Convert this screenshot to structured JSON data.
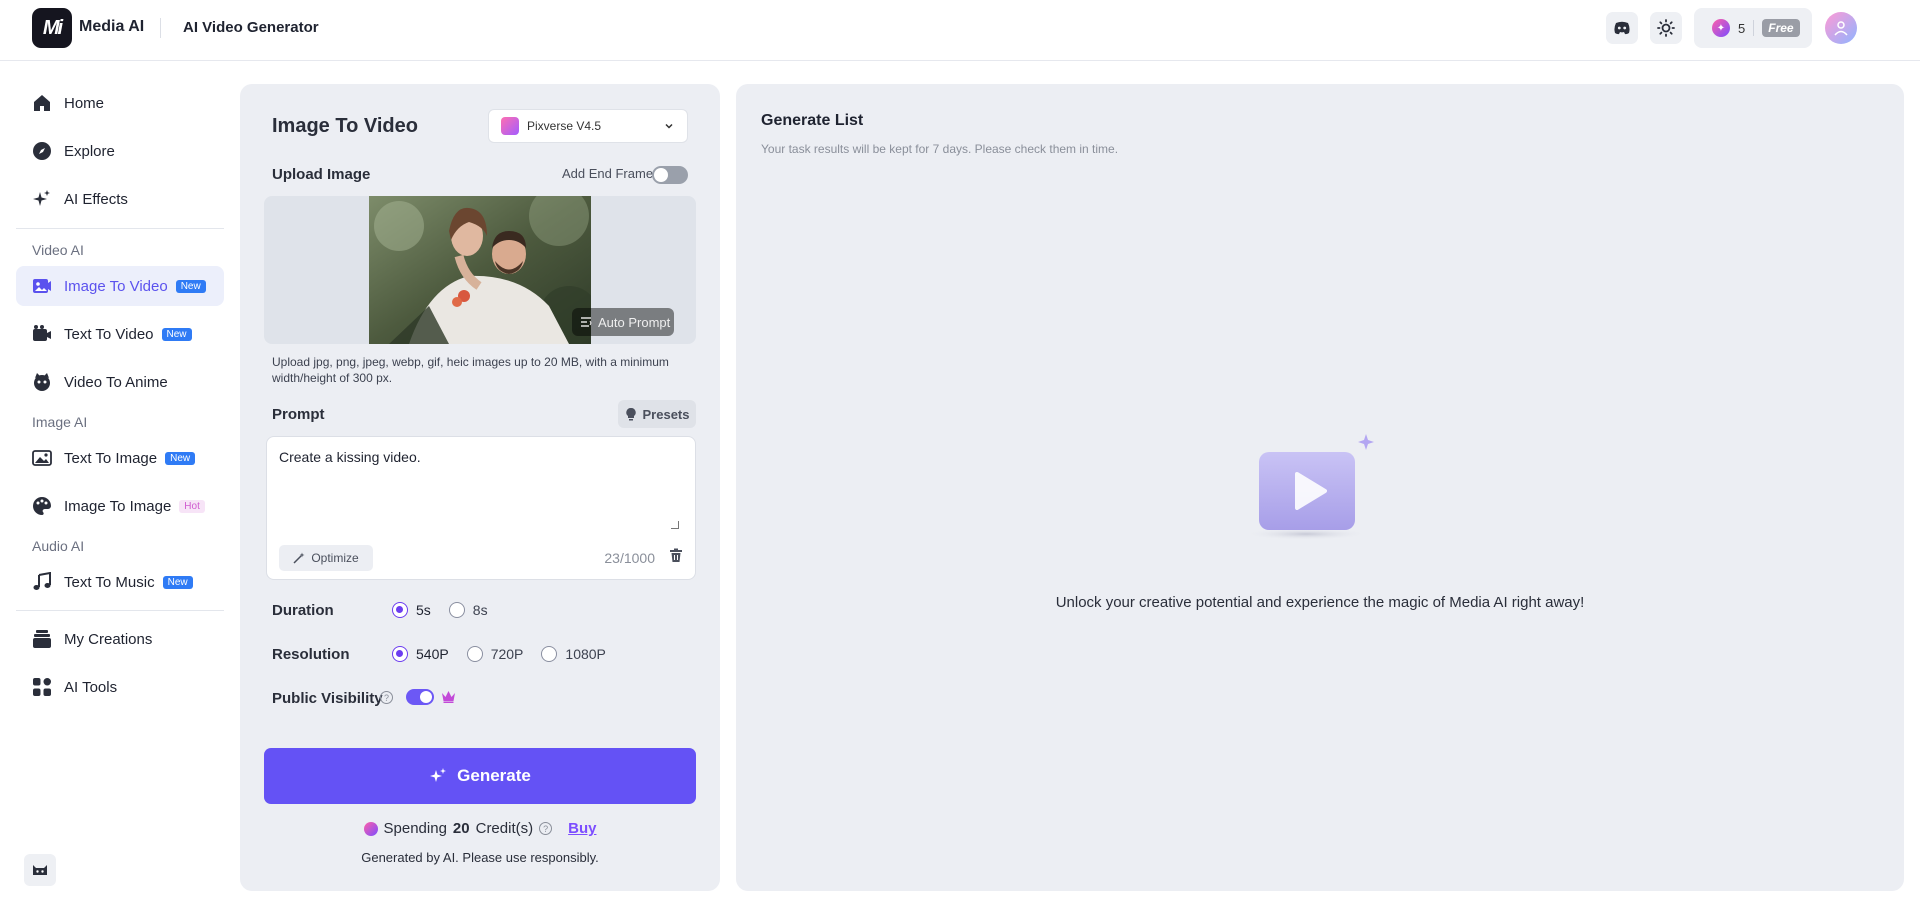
{
  "header": {
    "logo_text": "Mi",
    "app_name": "Media AI",
    "page_title": "AI Video Generator",
    "credits": "5",
    "plan_badge": "Free"
  },
  "sidebar": {
    "items_top": [
      {
        "label": "Home",
        "icon": "home-icon"
      },
      {
        "label": "Explore",
        "icon": "compass-icon"
      },
      {
        "label": "AI Effects",
        "icon": "sparkles-icon"
      }
    ],
    "section_video": "Video AI",
    "video_items": [
      {
        "label": "Image To Video",
        "badge": "New",
        "active": true
      },
      {
        "label": "Text To Video",
        "badge": "New"
      },
      {
        "label": "Video To Anime",
        "badge": ""
      }
    ],
    "section_image": "Image AI",
    "image_items": [
      {
        "label": "Text To Image",
        "badge": "New"
      },
      {
        "label": "Image To Image",
        "badge": "Hot"
      }
    ],
    "section_audio": "Audio AI",
    "audio_items": [
      {
        "label": "Text To Music",
        "badge": "New"
      }
    ],
    "items_bottom": [
      {
        "label": "My Creations",
        "icon": "layers-icon"
      },
      {
        "label": "AI Tools",
        "icon": "grid-icon"
      }
    ]
  },
  "form": {
    "title": "Image To Video",
    "model": "Pixverse V4.5",
    "upload_label": "Upload Image",
    "end_frame_label": "Add End Frame",
    "end_frame_on": false,
    "auto_prompt": "Auto Prompt",
    "upload_hint": "Upload jpg, png, jpeg, webp, gif, heic images up to 20 MB, with a minimum width/height of 300 px.",
    "prompt_label": "Prompt",
    "presets": "Presets",
    "prompt_value": "Create a kissing video.",
    "optimize": "Optimize",
    "char_count": "23/1000",
    "duration_label": "Duration",
    "duration_options": [
      "5s",
      "8s"
    ],
    "duration_selected": "5s",
    "resolution_label": "Resolution",
    "resolution_options": [
      "540P",
      "720P",
      "1080P"
    ],
    "resolution_selected": "540P",
    "visibility_label": "Public Visibility",
    "visibility_on": true,
    "generate": "Generate",
    "spending_prefix": "Spending",
    "spending_amount": "20",
    "spending_suffix": "Credit(s)",
    "buy": "Buy",
    "ai_note": "Generated by AI. Please use responsibly."
  },
  "list": {
    "title": "Generate List",
    "subtitle": "Your task results will be kept for 7 days. Please check them in time.",
    "empty_text": "Unlock your creative potential and experience the magic of Media AI right away!"
  },
  "colors": {
    "accent": "#6452f5",
    "panel_bg": "#eceef3"
  }
}
